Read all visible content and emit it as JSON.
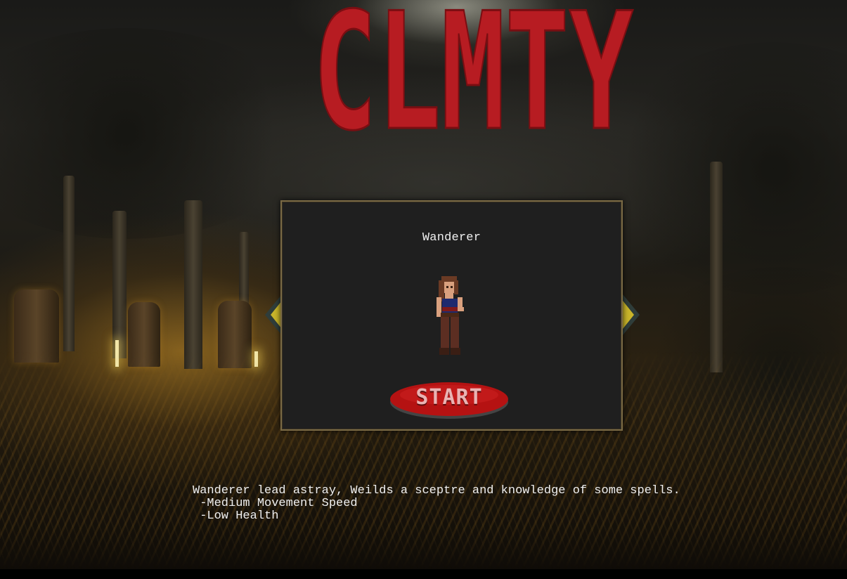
{
  "game": {
    "title": "CLMTY"
  },
  "character_select": {
    "name": "Wanderer",
    "start_label": "START",
    "prev_icon": "triangle-left",
    "next_icon": "triangle-right"
  },
  "description": {
    "summary": "Wanderer lead astray, Weilds a sceptre and knowledge of some spells.",
    "traits": [
      " -Medium Movement Speed",
      " -Low Health"
    ]
  },
  "colors": {
    "title_red": "#b71c22",
    "panel_bg": "#1f1f1f",
    "panel_border": "#7a6a45",
    "arrow_yellow": "#c9b52a",
    "arrow_dark": "#2f3d3a",
    "start_red": "#b51212"
  }
}
